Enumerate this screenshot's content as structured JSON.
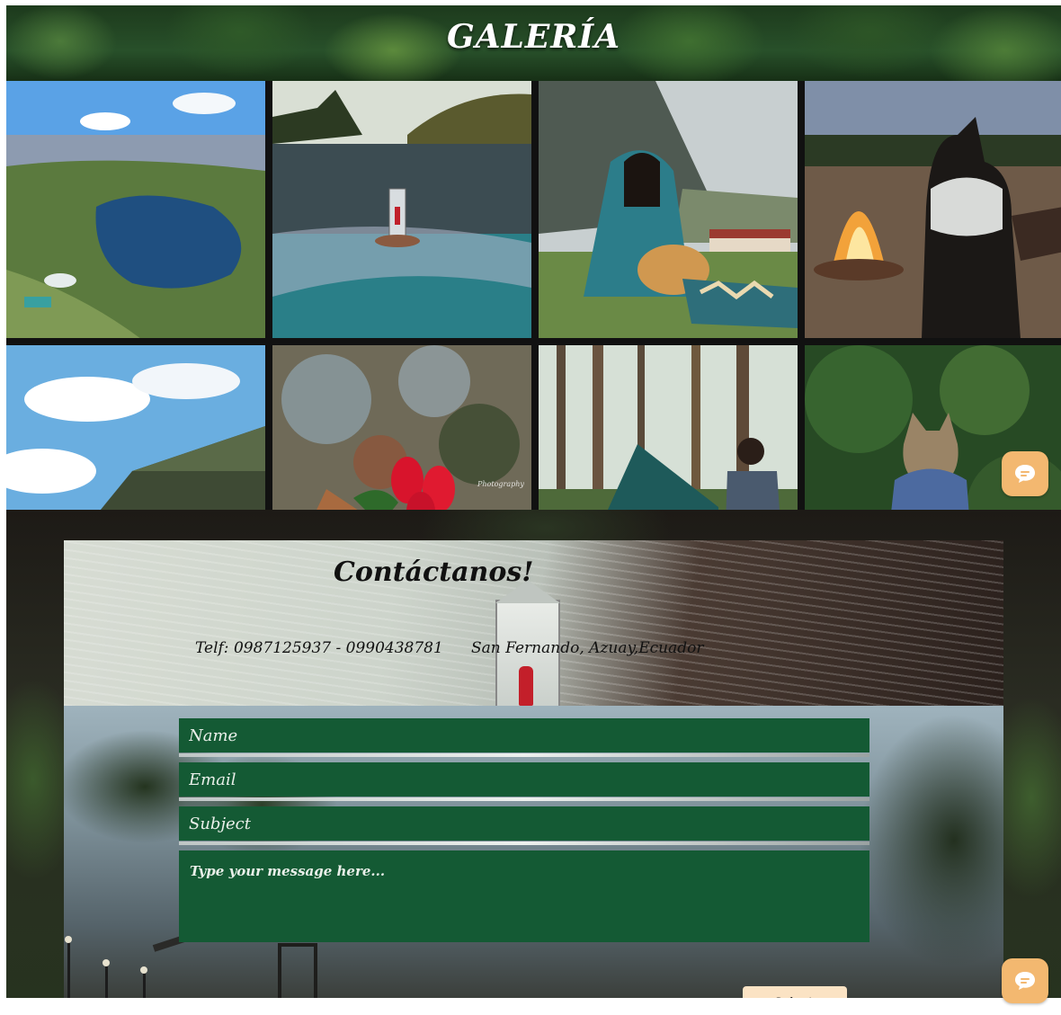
{
  "gallery": {
    "title": "GALERÍA",
    "photos": [
      {
        "icon": "lake-aerial-photo"
      },
      {
        "icon": "lake-reflection-photo"
      },
      {
        "icon": "woman-with-dog-photo"
      },
      {
        "icon": "campfire-dog-photo"
      },
      {
        "icon": "sky-mountain-photo"
      },
      {
        "icon": "red-flowers-photo",
        "watermark": "Photography"
      },
      {
        "icon": "tent-camping-photo"
      },
      {
        "icon": "cat-in-forest-photo"
      }
    ]
  },
  "contact": {
    "title": "Contáctanos!",
    "phone": "Telf:  0987125937 - 0990438781",
    "address": "San Fernando, Azuay,Ecuador",
    "form": {
      "name_placeholder": "Name",
      "email_placeholder": "Email",
      "subject_placeholder": "Subject",
      "message_placeholder": "Type your message here...",
      "submit_label": "Submit"
    }
  },
  "chat": {
    "icon": "chat-bubble-icon",
    "color": "#f3b870"
  },
  "colors": {
    "form_field": "#145a34",
    "submit_button": "#fbe3c4"
  }
}
